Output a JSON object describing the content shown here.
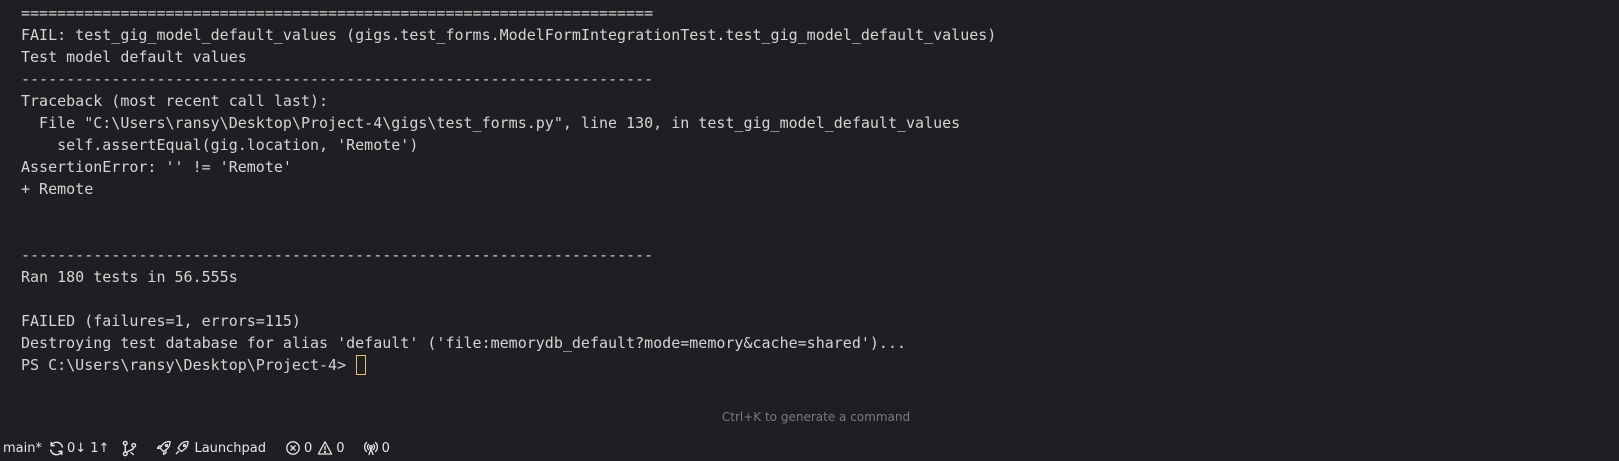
{
  "terminal": {
    "lines": [
      "======================================================================",
      "FAIL: test_gig_model_default_values (gigs.test_forms.ModelFormIntegrationTest.test_gig_model_default_values)",
      "Test model default values",
      "----------------------------------------------------------------------",
      "Traceback (most recent call last):",
      "  File \"C:\\Users\\ransy\\Desktop\\Project-4\\gigs\\test_forms.py\", line 130, in test_gig_model_default_values",
      "    self.assertEqual(gig.location, 'Remote')",
      "AssertionError: '' != 'Remote'",
      "+ Remote",
      "",
      "",
      "----------------------------------------------------------------------",
      "Ran 180 tests in 56.555s",
      "",
      "FAILED (failures=1, errors=115)",
      "Destroying test database for alias 'default' ('file:memorydb_default?mode=memory&cache=shared')..."
    ],
    "prompt": "PS C:\\Users\\ransy\\Desktop\\Project-4> ",
    "hint": "Ctrl+K to generate a command",
    "cursor_color": "#e5c07b"
  },
  "statusbar": {
    "branch": "main*",
    "sync": "0↓ 1↑",
    "launchpad": "Launchpad",
    "errors": "0",
    "warnings": "0",
    "ports": "0",
    "icons": {
      "sync": "sync-icon",
      "branch_graph": "source-control-graph-icon",
      "launchpad": "rocket-icon",
      "errors": "error-circle-icon",
      "warnings": "warning-triangle-icon",
      "ports": "broadcast-icon"
    }
  }
}
